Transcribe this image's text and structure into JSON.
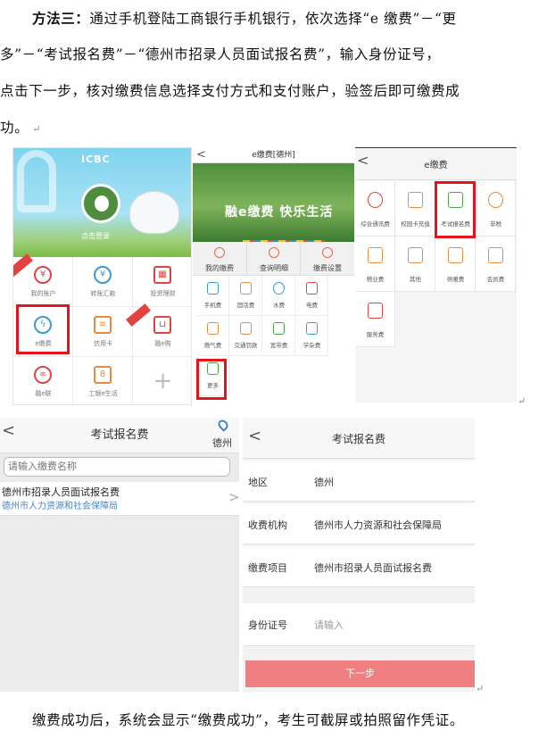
{
  "intro": {
    "label": "方法三：",
    "line1": "通过手机登陆工商银行手机银行，依次选择“e 缴费”－“更",
    "line2": "多”－“考试报名费”－“德州市招录人员面试报名费”，输入身份证号，",
    "line3": "点击下一步，核对缴费信息选择支付方式和支付账户，验签后即可缴费成",
    "line4": "功。"
  },
  "return_mark": "↵",
  "screen1": {
    "bank_name": "ICBC",
    "login_hint": "点击登录",
    "items": [
      "我的账户",
      "转账汇款",
      "投资理财",
      "e缴费",
      "信用卡",
      "融e购",
      "融e联",
      "工银e生活"
    ],
    "add": "+"
  },
  "screen2": {
    "back": "<",
    "title": "e缴费[德州]",
    "slogan": "融e缴费  快乐生活",
    "tabs": [
      "我的缴费",
      "查询明细",
      "缴费设置"
    ],
    "items": [
      "手机费",
      "固话费",
      "水费",
      "电费",
      "燃气费",
      "交通罚款",
      "宽带费",
      "学杂费",
      "更多"
    ]
  },
  "screen3": {
    "back": "<",
    "title": "e缴费",
    "items": [
      "综合通讯费",
      "校园卡充值",
      "考试报名费",
      "非税",
      "物业费",
      "其他",
      "供暖费",
      "会员费",
      "服务费"
    ]
  },
  "screen4": {
    "back": "<",
    "title": "考试报名费",
    "city": "德州",
    "search_placeholder": "请输入缴费名称",
    "item_title": "德州市招录人员面试报名费",
    "item_sub": "德州市人力资源和社会保障局",
    "chevron": ">"
  },
  "screen5": {
    "back": "<",
    "title": "考试报名费",
    "rows": [
      {
        "key": "地区",
        "value": "德州"
      },
      {
        "key": "收费机构",
        "value": "德州市人力资源和社会保障局"
      },
      {
        "key": "缴费项目",
        "value": "德州市招录人员面试报名费"
      },
      {
        "key": "身份证号",
        "value": "请输入"
      }
    ],
    "next_button": "下一步"
  },
  "closing": "缴费成功后，系统会显示“缴费成功”，考生可截屏或拍照留作凭证。"
}
